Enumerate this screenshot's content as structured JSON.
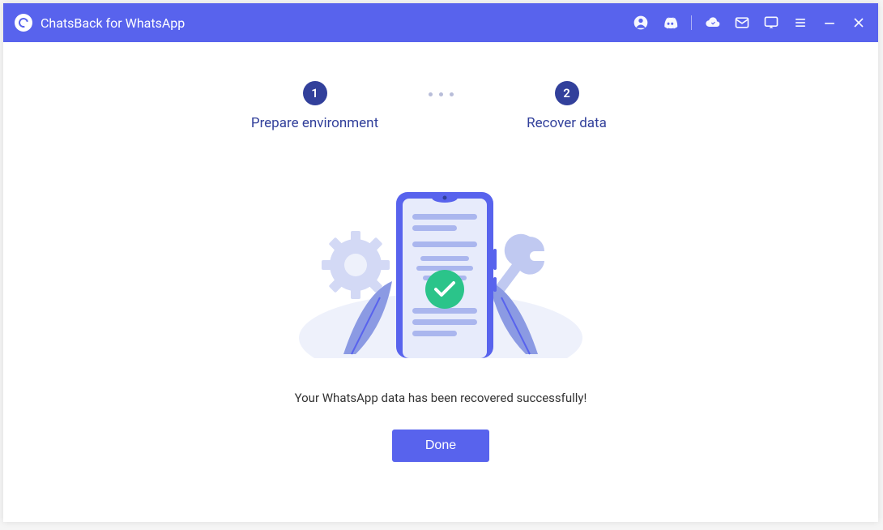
{
  "titlebar": {
    "app_title": "ChatsBack for WhatsApp"
  },
  "steps": {
    "step1": {
      "num": "1",
      "label": "Prepare environment"
    },
    "step2": {
      "num": "2",
      "label": "Recover data"
    }
  },
  "main": {
    "status_message": "Your WhatsApp data has been recovered successfully!",
    "done_label": "Done"
  }
}
